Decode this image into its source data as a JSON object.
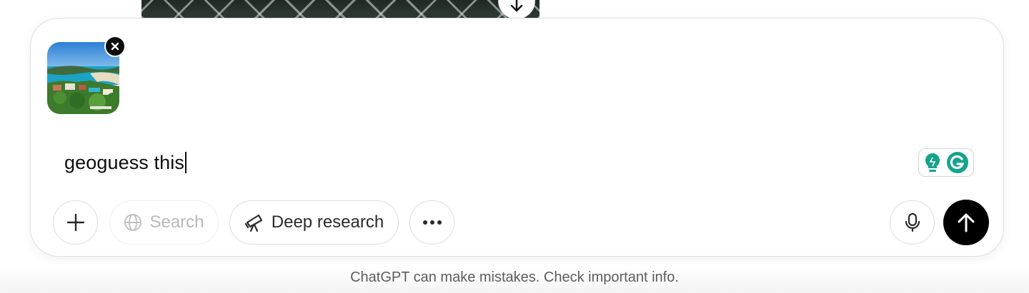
{
  "attachment": {
    "photo_icon": "beach-resort-photo",
    "remove_icon": "close-icon"
  },
  "composer": {
    "prompt_text": "geoguess this",
    "grammarly_icons": [
      "lightbulb-icon",
      "grammarly-g-icon"
    ]
  },
  "toolbar": {
    "plus_icon": "plus-icon",
    "search_label": "Search",
    "search_icon": "globe-icon",
    "deep_research_label": "Deep research",
    "deep_research_icon": "telescope-icon",
    "more_icon": "ellipsis-icon",
    "mic_icon": "microphone-icon",
    "send_icon": "arrow-up-icon"
  },
  "footer": {
    "disclaimer": "ChatGPT can make mistakes. Check important info."
  },
  "colors": {
    "send_bg": "#000000",
    "grammarly_teal": "#15a38c",
    "disclaimer_text": "#5d5d5d"
  }
}
